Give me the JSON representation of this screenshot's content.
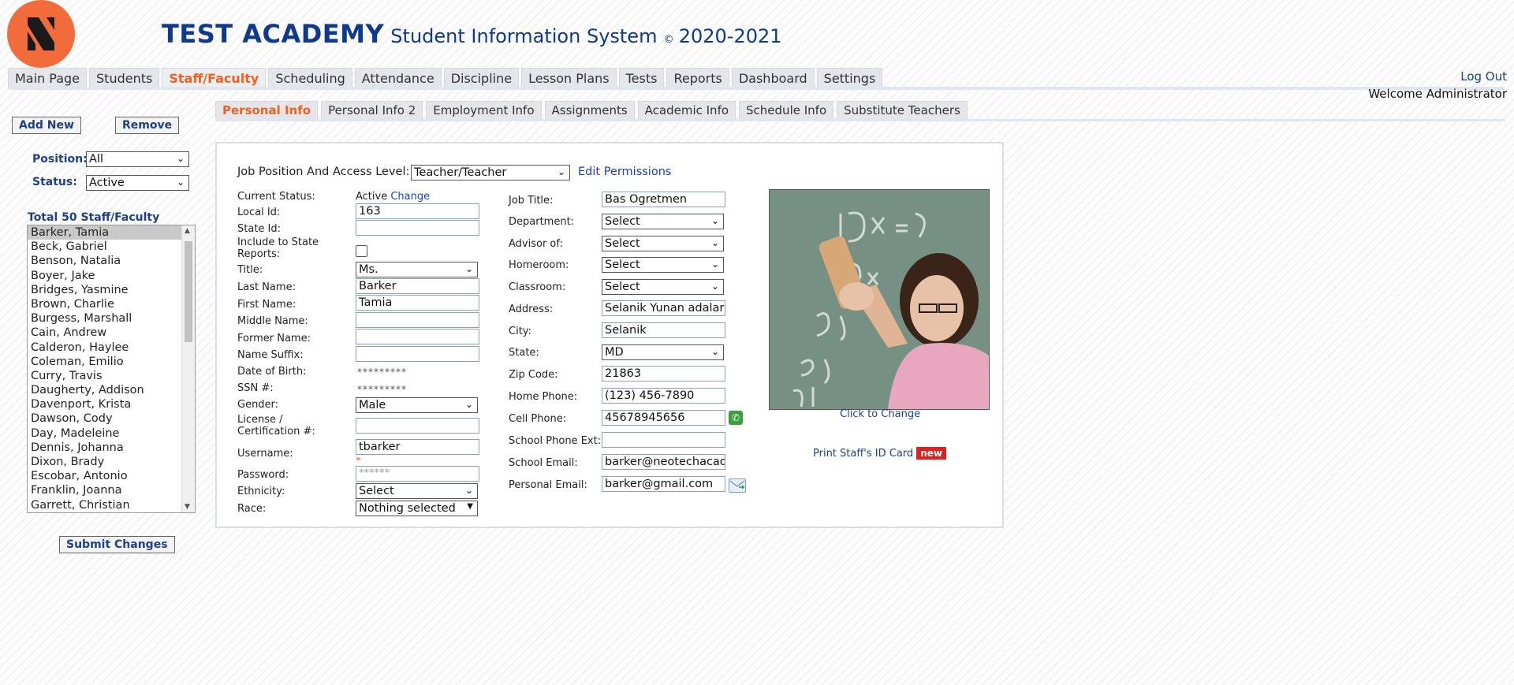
{
  "header": {
    "school": "TEST ACADEMY",
    "system": "Student Information System",
    "copyright": "©",
    "year": "2020-2021",
    "logout": "Log Out",
    "welcome": "Welcome Administrator"
  },
  "main_nav": [
    {
      "label": "Main Page"
    },
    {
      "label": "Students"
    },
    {
      "label": "Staff/Faculty",
      "active": true
    },
    {
      "label": "Scheduling"
    },
    {
      "label": "Attendance"
    },
    {
      "label": "Discipline"
    },
    {
      "label": "Lesson Plans"
    },
    {
      "label": "Tests"
    },
    {
      "label": "Reports"
    },
    {
      "label": "Dashboard"
    },
    {
      "label": "Settings"
    }
  ],
  "sub_nav": [
    {
      "label": "Personal Info",
      "active": true
    },
    {
      "label": "Personal Info 2"
    },
    {
      "label": "Employment Info"
    },
    {
      "label": "Assignments"
    },
    {
      "label": "Academic Info"
    },
    {
      "label": "Schedule Info"
    },
    {
      "label": "Substitute Teachers"
    }
  ],
  "sidebar": {
    "add_new": "Add New",
    "remove": "Remove",
    "position_label": "Position:",
    "position_value": "All",
    "status_label": "Status:",
    "status_value": "Active",
    "total": "Total 50 Staff/Faculty",
    "staff": [
      "Barker, Tamia",
      "Beck, Gabriel",
      "Benson, Natalia",
      "Boyer, Jake",
      "Bridges, Yasmine",
      "Brown, Charlie",
      "Burgess, Marshall",
      "Cain, Andrew",
      "Calderon, Haylee",
      "Coleman, Emilio",
      "Curry, Travis",
      "Daugherty, Addison",
      "Davenport, Krista",
      "Dawson, Cody",
      "Day, Madeleine",
      "Dennis, Johanna",
      "Dixon, Brady",
      "Escobar, Antonio",
      "Franklin, Joanna",
      "Garrett, Christian"
    ],
    "selected_index": 0,
    "submit": "Submit Changes"
  },
  "form": {
    "job_position_label": "Job Position And Access Level:",
    "job_position_value": "Teacher/Teacher",
    "edit_permissions": "Edit Permissions",
    "current_status_label": "Current Status:",
    "current_status_value": "Active",
    "change_link": "Change",
    "local_id_label": "Local Id:",
    "local_id": "163",
    "state_id_label": "State Id:",
    "state_id": "",
    "include_state_label": "Include to State Reports:",
    "title_label": "Title:",
    "title_value": "Ms.",
    "last_name_label": "Last Name:",
    "last_name": "Barker",
    "first_name_label": "First Name:",
    "first_name": "Tamia",
    "middle_name_label": "Middle Name:",
    "middle_name": "",
    "former_name_label": "Former Name:",
    "former_name": "",
    "suffix_label": "Name Suffix:",
    "suffix": "",
    "dob_label": "Date of Birth:",
    "dob_mask": "*********",
    "ssn_label": "SSN #:",
    "ssn_mask": "*********",
    "gender_label": "Gender:",
    "gender_value": "Male",
    "license_label": "License / Certification #:",
    "license": "",
    "username_label": "Username:",
    "username": "tbarker",
    "password_label": "Password:",
    "password_mask": "******",
    "ethnicity_label": "Ethnicity:",
    "ethnicity_value": "Select",
    "race_label": "Race:",
    "race_value": "Nothing selected",
    "job_title_label": "Job Title:",
    "job_title": "Bas Ogretmen",
    "department_label": "Department:",
    "department_value": "Select",
    "advisor_label": "Advisor of:",
    "advisor_value": "Select",
    "homeroom_label": "Homeroom:",
    "homeroom_value": "Select",
    "classroom_label": "Classroom:",
    "classroom_value": "Select",
    "address_label": "Address:",
    "address": "Selanik Yunan adalari",
    "city_label": "City:",
    "city": "Selanik",
    "state_label": "State:",
    "state_value": "MD",
    "zip_label": "Zip Code:",
    "zip": "21863",
    "home_phone_label": "Home Phone:",
    "home_phone": "(123) 456-7890",
    "cell_phone_label": "Cell Phone:",
    "cell_phone": "45678945656",
    "school_ext_label": "School Phone Ext:",
    "school_ext": "",
    "school_email_label": "School Email:",
    "school_email": "barker@neotechacademy.com",
    "personal_email_label": "Personal Email:",
    "personal_email": "barker@gmail.com",
    "click_to_change": "Click to Change",
    "print_id": "Print Staff's ID Card",
    "new_badge": "new"
  },
  "colors": {
    "brand": "#0d3a8c",
    "active_tab": "#f06020",
    "logo": "#f26b3a",
    "link": "#1a3fb0"
  }
}
